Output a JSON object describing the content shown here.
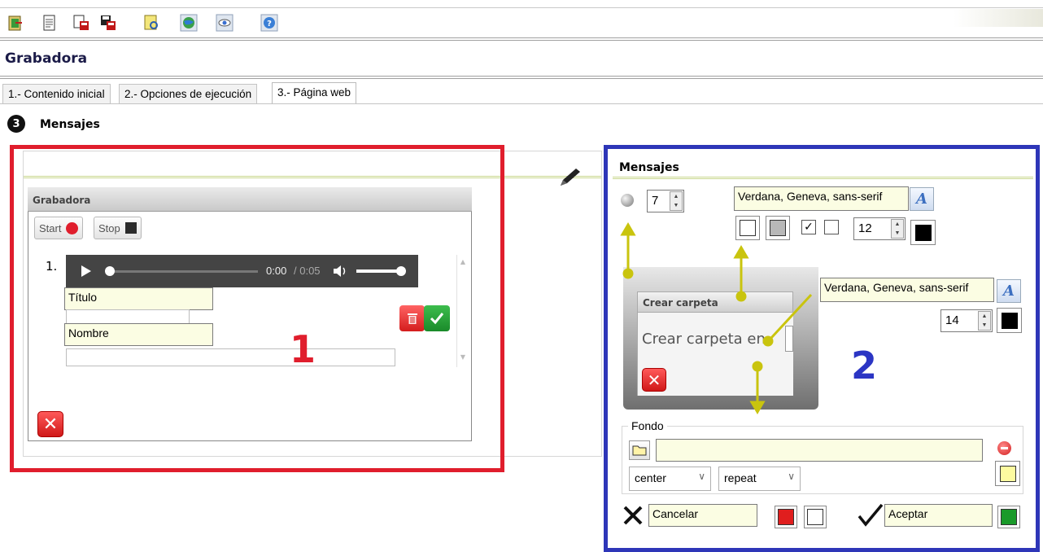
{
  "toolbar": {
    "icons": [
      "exit-icon",
      "document-icon",
      "save-as-icon",
      "save-icon",
      "preview-icon",
      "globe-icon",
      "view-icon",
      "help-icon"
    ]
  },
  "app": {
    "title": "Grabadora"
  },
  "tabs": [
    {
      "label": "1.- Contenido inicial"
    },
    {
      "label": "2.- Opciones de ejecución"
    },
    {
      "label": "3.- Página web",
      "active": true
    }
  ],
  "section": {
    "number": "3",
    "title": "Mensajes"
  },
  "left_preview": {
    "dialog_title": "Grabadora",
    "start_label": "Start",
    "stop_label": "Stop",
    "item_number": "1.",
    "player_time": "0:00",
    "player_duration": "/ 0:05",
    "title_label": "Título",
    "name_label": "Nombre",
    "marker": "1"
  },
  "right_panel": {
    "title": "Mensajes",
    "border_radius_value": "7",
    "font_family_1": "Verdana, Geneva, sans-serif",
    "font_size_1": "12",
    "font_family_2": "Verdana, Geneva, sans-serif",
    "font_size_2": "14",
    "preview_title": "Crear carpeta",
    "preview_text": "Crear carpeta en",
    "marker": "2",
    "fondo_legend": "Fondo",
    "fondo_path": "",
    "position_select": "center",
    "repeat_select": "repeat",
    "cancel_label": "Cancelar",
    "accept_label": "Aceptar"
  },
  "colors": {
    "accent_red": "#e01e2d",
    "accent_blue": "#2e36b8",
    "field_yellow": "#fbfde3",
    "cancel_swatch": "#e01e1e",
    "accept_swatch": "#1a9a2a",
    "bg_swatch": "#fdfba0"
  }
}
